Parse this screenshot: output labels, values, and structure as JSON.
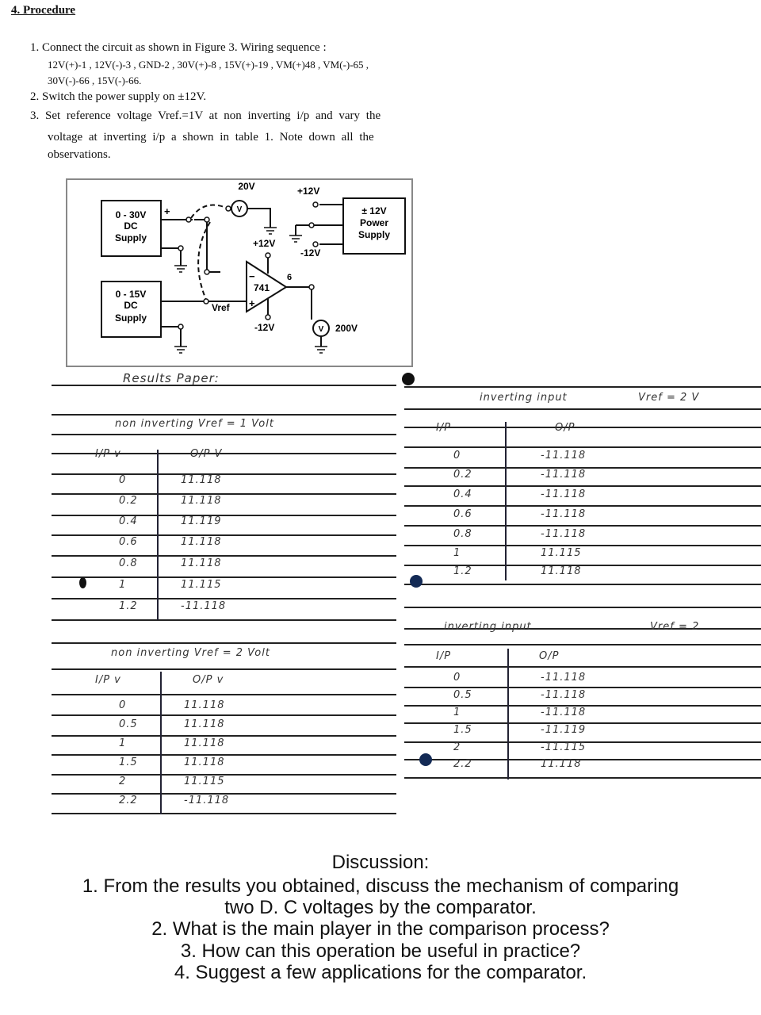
{
  "procedure": {
    "heading": "4.  Procedure",
    "steps": [
      "1.  Connect the circuit as shown in Figure 3. Wiring sequence :",
      "12V(+)-1 , 12V(-)-3 , GND-2 , 30V(+)-8 , 15V(+)-19 , VM(+)48 , VM(-)-65 ,",
      "30V(-)-66 , 15V(-)-66.",
      "2.  Switch the power supply on  ±12V.",
      "3.  Set reference voltage Vref.=1V at non inverting i/p and vary the",
      "voltage at inverting i/p a shown in table 1. Note down all the",
      "observations."
    ]
  },
  "circuit": {
    "supply1": [
      "0 - 30V",
      "DC",
      "Supply"
    ],
    "supply2": [
      "0 - 15V",
      "DC",
      "Supply"
    ],
    "power": [
      "± 12V",
      "Power",
      "Supply"
    ],
    "plus": "+",
    "voltmeter1": "20V",
    "voltmeter2": "200V",
    "v": "V",
    "p12": "+12V",
    "m12": "-12V",
    "opamp": "741",
    "pin": "6",
    "vref": "Vref",
    "minus_sign": "−",
    "plus_sign": "+"
  },
  "results": {
    "title": "Results Paper:",
    "tables": [
      {
        "title": "non inverting Vref = 1 Volt",
        "headers": [
          "I/P v",
          "O/P V"
        ],
        "inputs": [
          "0",
          "0.2",
          "0.4",
          "0.6",
          "0.8",
          "1",
          "1.2"
        ],
        "outputs": [
          "11.118",
          "11.118",
          "11.119",
          "11.118",
          "11.118",
          "11.115",
          "-11.118"
        ]
      },
      {
        "title": "inverting input",
        "title2": "Vref = 2 V",
        "headers": [
          "I/P",
          "O/P"
        ],
        "inputs": [
          "0",
          "0.2",
          "0.4",
          "0.6",
          "0.8",
          "1",
          "1.2"
        ],
        "outputs": [
          "-11.118",
          "-11.118",
          "-11.118",
          "-11.118",
          "-11.118",
          "11.115",
          "11.118"
        ]
      },
      {
        "title": "non inverting Vref = 2 Volt",
        "headers": [
          "I/P v",
          "O/P v"
        ],
        "inputs": [
          "0",
          "0.5",
          "1",
          "1.5",
          "2",
          "2.2"
        ],
        "outputs": [
          "11.118",
          "11.118",
          "11.118",
          "11.118",
          "11.115",
          "-11.118"
        ]
      },
      {
        "title": "inverting input",
        "title2": "Vref = 2",
        "headers": [
          "I/P",
          "O/P"
        ],
        "inputs": [
          "0",
          "0.5",
          "1",
          "1.5",
          "2",
          "2.2"
        ],
        "outputs": [
          "-11.118",
          "-11.118",
          "-11.118",
          "-11.119",
          "-11.115",
          "11.118"
        ]
      }
    ]
  },
  "discussion": {
    "heading": "Discussion:",
    "lines": [
      "1. From the results you obtained, discuss the mechanism of comparing",
      "two D. C voltages by the comparator.",
      "2. What is the main player in the comparison process?",
      "3. How can this operation be useful in practice?",
      "4. Suggest a few applications for the comparator."
    ]
  }
}
